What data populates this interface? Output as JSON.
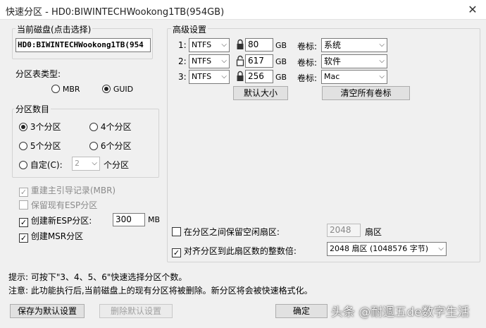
{
  "window": {
    "title": "快速分区 - HD0:BIWINTECHWookong1TB(954GB)",
    "close": "✕"
  },
  "current_disk": {
    "label": "当前磁盘(点击选择)",
    "value": "HD0:BIWINTECHWookong1TB(954"
  },
  "table_type": {
    "label": "分区表类型:",
    "mbr": "MBR",
    "guid": "GUID",
    "selected": "GUID"
  },
  "partition_count": {
    "label": "分区数目",
    "options": [
      "3个分区",
      "4个分区",
      "5个分区",
      "6个分区"
    ],
    "selected": "3个分区",
    "custom_label": "自定(C):",
    "custom_value": "2",
    "custom_suffix": "个分区"
  },
  "options": {
    "rebuild_mbr": "重建主引导记录(MBR)",
    "keep_esp": "保留现有ESP分区",
    "create_esp": "创建新ESP分区:",
    "esp_size": "300",
    "esp_unit": "MB",
    "create_msr": "创建MSR分区"
  },
  "advanced": {
    "label": "高级设置",
    "rows": [
      {
        "index": "1:",
        "fs": "NTFS",
        "size": "80",
        "unit": "GB",
        "vol_label_text": "卷标:",
        "vol_label": "系统",
        "locked": true
      },
      {
        "index": "2:",
        "fs": "NTFS",
        "size": "617",
        "unit": "GB",
        "vol_label_text": "卷标:",
        "vol_label": "软件",
        "locked": false
      },
      {
        "index": "3:",
        "fs": "NTFS",
        "size": "256",
        "unit": "GB",
        "vol_label_text": "卷标:",
        "vol_label": "Mac",
        "locked": true
      }
    ],
    "default_size_btn": "默认大小",
    "clear_labels_btn": "清空所有卷标",
    "reserve_free": "在分区之间保留空闲扇区:",
    "reserve_value": "2048",
    "reserve_unit": "扇区",
    "align": "对齐分区到此扇区数的整数倍:",
    "align_value": "2048 扇区 (1048576 字节)"
  },
  "hints": {
    "tip": "提示: 可按下\"3、4、5、6\"快速选择分区个数。",
    "note": "注意: 此功能执行后,当前磁盘上的现有分区将被删除。新分区将会被快速格式化。"
  },
  "buttons": {
    "save_default": "保存为默认设置",
    "delete_default": "删除默认设置",
    "ok": "确定"
  },
  "watermark": "头条 @耐週五de数字生活"
}
